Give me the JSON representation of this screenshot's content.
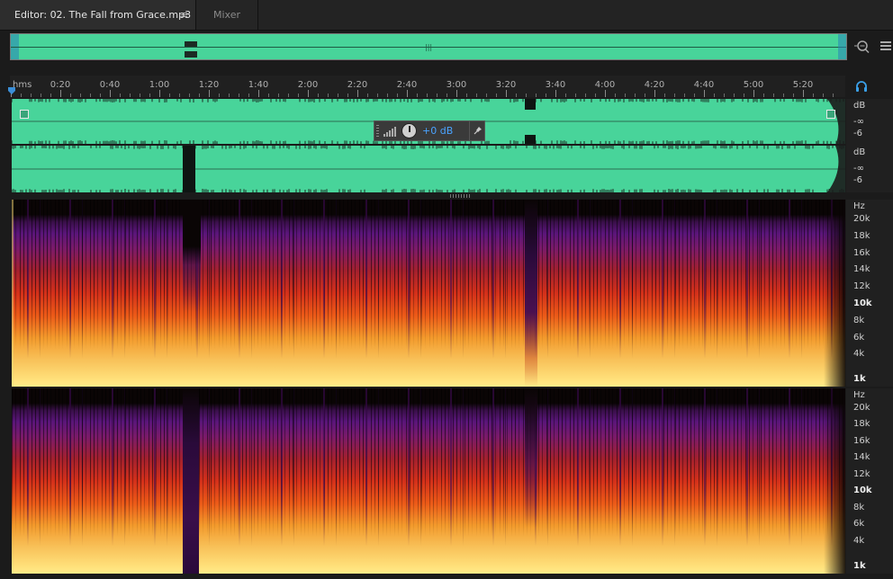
{
  "tabs": {
    "editor_label": "Editor: 02. The Fall from Grace.mp3",
    "editor_menu_glyph": "≡",
    "mixer_label": "Mixer"
  },
  "ruler": {
    "unit_label": "hms",
    "ticks": [
      "0:20",
      "0:40",
      "1:00",
      "1:20",
      "1:40",
      "2:00",
      "2:20",
      "2:40",
      "3:00",
      "3:20",
      "3:40",
      "4:00",
      "4:20",
      "4:40",
      "5:00",
      "5:20"
    ]
  },
  "gain_hud": {
    "value": "+0 dB"
  },
  "waveform": {
    "db_unit": "dB",
    "db_labels": [
      "-∞",
      "-6"
    ]
  },
  "spectrogram": {
    "unit": "Hz",
    "labels": [
      "20k",
      "18k",
      "16k",
      "14k",
      "12k",
      "10k",
      "8k",
      "6k",
      "4k",
      "1k"
    ]
  },
  "icons": {
    "zoom": "zoom-icon",
    "panel": "panel-menu-icon",
    "headphones": "headphones-icon",
    "pin": "pin-icon"
  },
  "colors": {
    "waveform": "#48d49a",
    "accent": "#4aa3ff"
  }
}
